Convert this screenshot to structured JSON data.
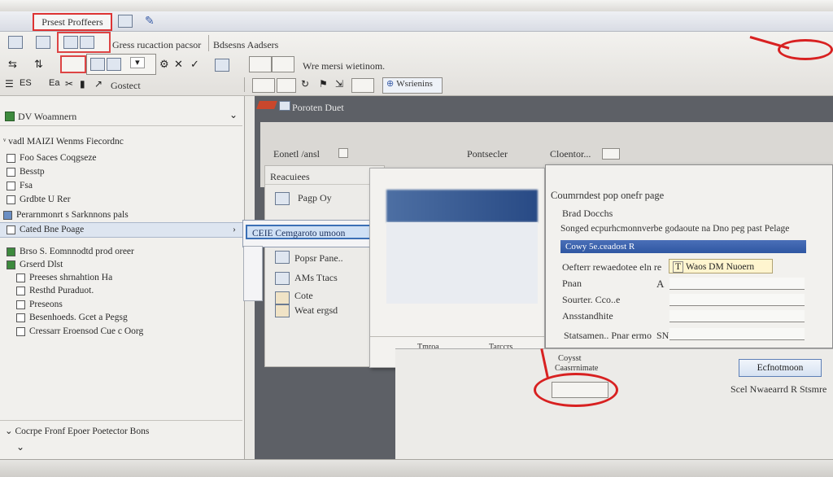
{
  "title_tab": "Prsest Proffeers",
  "ribbon": {
    "row1_left": "Gress rucaction pacsor",
    "row1_right": "Bdsesns Aadsers",
    "row2_text": "Wre mersi wietinom.",
    "row3_left": "Gostect",
    "row3_right": "Wsrienins"
  },
  "left_panel": {
    "header": "DV Woamnern",
    "group1": "vadl MAIZI Wenms Fiecordnc",
    "items1": [
      "Foo Saces Coqgseze",
      "Besstp",
      "Fsa",
      "Grdbte U Rer"
    ],
    "group2": "Perarnmonrt s Sarknnons pals",
    "selected_item": "Cated Bne Poage",
    "items2": [
      "Brso S. Eomnnodtd prod oreer",
      "Grserd Dlst",
      "Preeses shrnahtion Ha",
      "Resthd Puraduot.",
      "Preseons",
      "Besenhoeds. Gcet a Pegsg",
      "Cressarr Eroensod Cue c Oorg"
    ],
    "footer_item": "Cocrpe Fronf Epoer Poetector Bons"
  },
  "middle": {
    "header": "Poroten Duet",
    "row_left": "Eonetl /ansl",
    "row_mid": "Pontsecler",
    "row_right": "Cloentor...",
    "subpanel_title": "Reacuiees",
    "sub_items": [
      "Pagp Oy",
      "Popsr Pane..",
      "AMs Ttacs",
      "Cote",
      "Weat ergsd"
    ],
    "menu_selected": "CEIE Cemgaroto umoon",
    "midwin_bottom_left": "Tmroa",
    "midwin_bottom_right": "Tarccrs"
  },
  "dialog": {
    "title": "Coumrndest pop onefr page",
    "line1": "Brad Docchs",
    "line2": "Songed ecpurhcmonnverbe godaoute na Dno peg past Pelage",
    "bluebar": "Cowy  5e.ceadost R",
    "field1_label": "Oefterr rewaedotee eln re",
    "field1_value": "Waos DM Nuoern",
    "field2_label": "Pnan",
    "field2_side": "A",
    "field3_label": "Sourter. Cco..e",
    "field4_label": "Ansstandhite",
    "field5_label": "Statsamen.. Pnar ermo",
    "field5_side": "SN"
  },
  "bottom": {
    "label_top": "Coysst",
    "label_sub": "Caasrrnimate",
    "button": "Ecfnotmoon",
    "footer_text": "Scel Nwaearrd R Stsmre"
  },
  "colors": {
    "annotation_red": "#d82121",
    "selection_blue": "#3b6fb6"
  }
}
